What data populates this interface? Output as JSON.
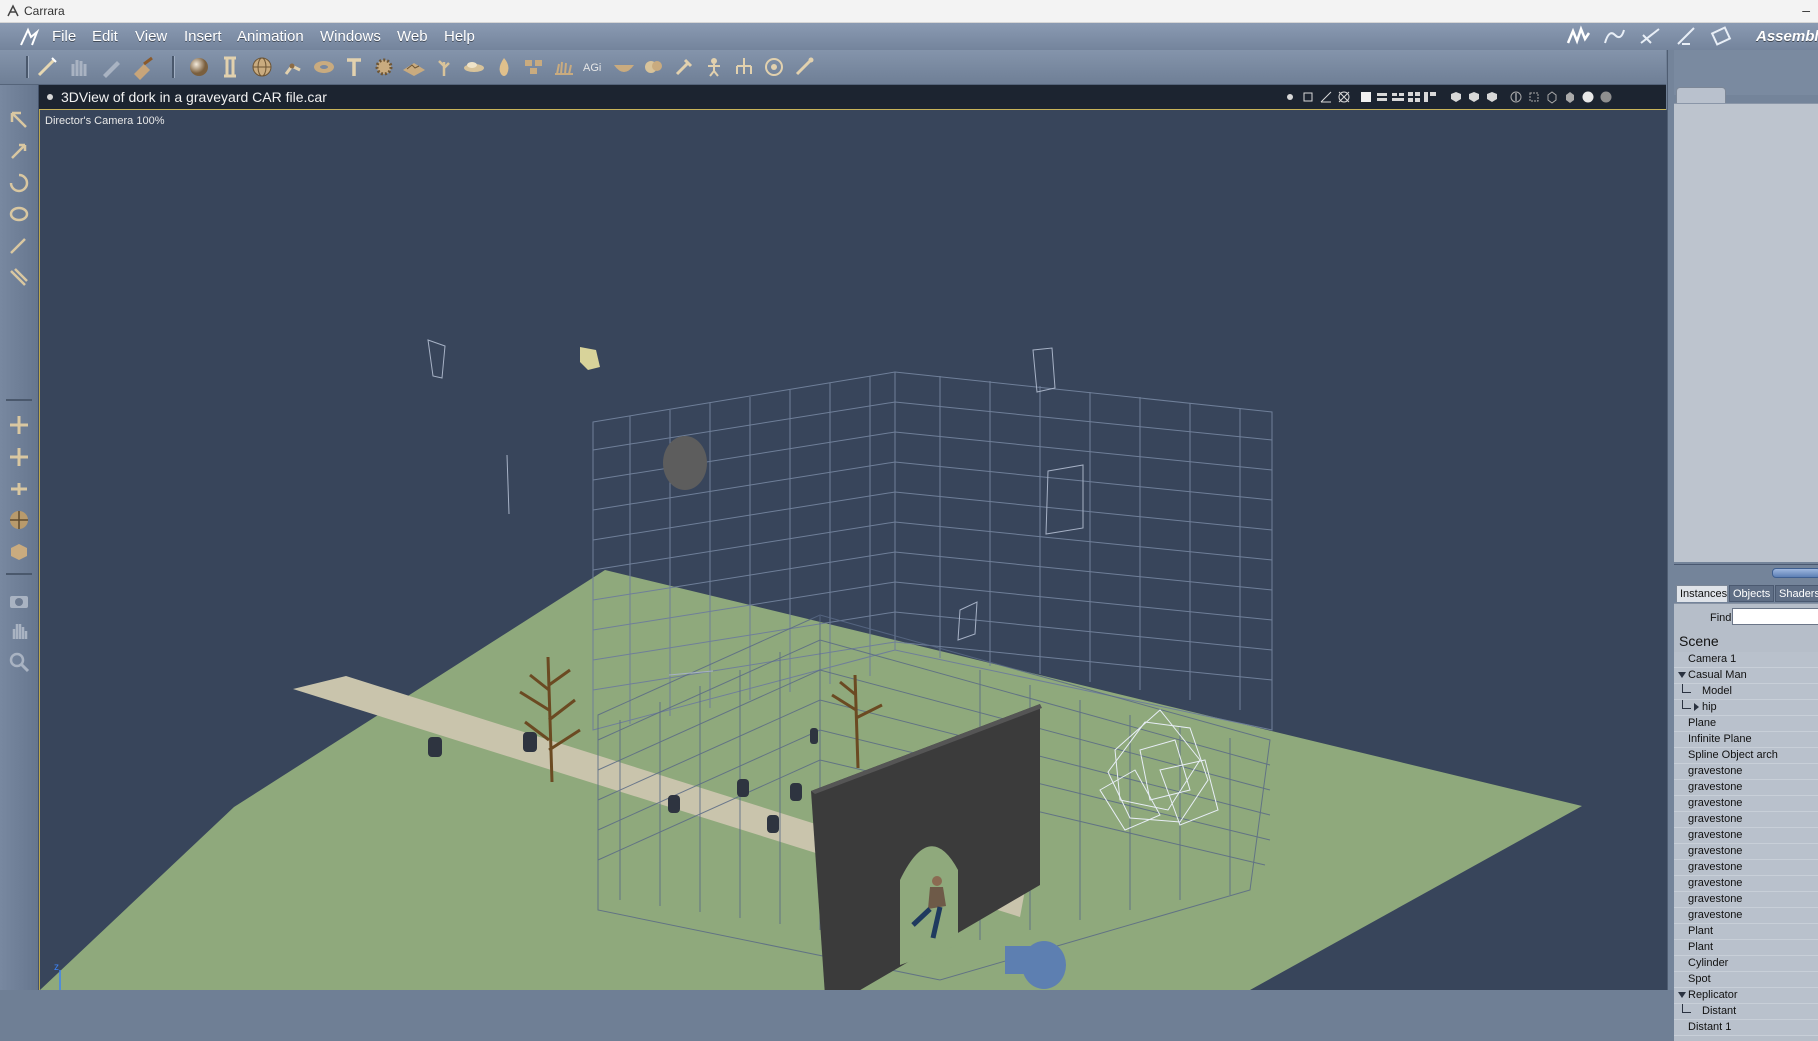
{
  "window": {
    "title": "Carrara",
    "minimize_glyph": "–"
  },
  "menubar": {
    "items": [
      "File",
      "Edit",
      "View",
      "Insert",
      "Animation",
      "Windows",
      "Web",
      "Help"
    ],
    "room_icons": [
      "assemble-room-icon",
      "model-room-icon",
      "storyboard-room-icon",
      "texture-room-icon",
      "render-room-icon"
    ],
    "room_label": "Assemble"
  },
  "toolbar": {
    "icons": [
      "fx-wand-icon",
      "hand-grab-icon",
      "pen-icon",
      "hammer-icon",
      "sphere-icon",
      "column-icon",
      "globe-grid-icon",
      "bone-chain-icon",
      "torus-icon",
      "text-T-icon",
      "gear-primitive-icon",
      "terrain-icon",
      "plant-icon",
      "cloud-icon",
      "fire-icon",
      "replicator-icon",
      "fur-icon",
      "AGi-icon",
      "bowl-icon",
      "metaball-icon",
      "pin-icon",
      "puppet-icon",
      "hierarchy-icon",
      "target-icon",
      "bone-icon"
    ]
  },
  "lefttools": {
    "icons": [
      "select-arrow-icon",
      "rotate-arrow-icon",
      "orbit-icon",
      "twist-icon",
      "paint-brush-icon",
      "knife-icon",
      "move-xy-icon",
      "move-xz-icon",
      "move-yz-icon",
      "trackball-icon",
      "shield-icon",
      "camera-icon",
      "hand-pan-icon",
      "zoom-icon"
    ]
  },
  "viewport": {
    "title": "3DView of dork in a graveyard CAR file.car",
    "camera_label": "Director's Camera 100%",
    "axis_label": "z",
    "header_icons": [
      "lights-icon",
      "grid-toggle-icon",
      "axes-icon",
      "crosshair-icon",
      "layout-single-icon",
      "layout-two-icon",
      "layout-three-icon",
      "layout-four-icon",
      "layout-custom-icon",
      "shield-a-icon",
      "shield-b-icon",
      "shield-c-icon",
      "up-arrow-icon",
      "bbox-icon",
      "wire-cube-icon",
      "solid-cube-icon",
      "sphere-shade-icon",
      "sphere-dark-icon"
    ]
  },
  "rightpanel": {
    "tabs": [
      "Instances",
      "Objects",
      "Shaders"
    ],
    "find_label": "Find:",
    "find_value": "",
    "scene_label": "Scene",
    "tree": [
      {
        "label": "Camera 1",
        "level": 0,
        "twisty": "none"
      },
      {
        "label": "Casual Man",
        "level": 0,
        "twisty": "open"
      },
      {
        "label": "Model",
        "level": 1,
        "twisty": "none"
      },
      {
        "label": "hip",
        "level": 1,
        "twisty": "closed"
      },
      {
        "label": "Plane",
        "level": 0,
        "twisty": "none"
      },
      {
        "label": "Infinite Plane",
        "level": 0,
        "twisty": "none"
      },
      {
        "label": "Spline Object arch",
        "level": 0,
        "twisty": "none"
      },
      {
        "label": "gravestone",
        "level": 0,
        "twisty": "none"
      },
      {
        "label": "gravestone",
        "level": 0,
        "twisty": "none"
      },
      {
        "label": "gravestone",
        "level": 0,
        "twisty": "none"
      },
      {
        "label": "gravestone",
        "level": 0,
        "twisty": "none"
      },
      {
        "label": "gravestone",
        "level": 0,
        "twisty": "none"
      },
      {
        "label": "gravestone",
        "level": 0,
        "twisty": "none"
      },
      {
        "label": "gravestone",
        "level": 0,
        "twisty": "none"
      },
      {
        "label": "gravestone",
        "level": 0,
        "twisty": "none"
      },
      {
        "label": "gravestone",
        "level": 0,
        "twisty": "none"
      },
      {
        "label": "gravestone",
        "level": 0,
        "twisty": "none"
      },
      {
        "label": "Plant",
        "level": 0,
        "twisty": "none"
      },
      {
        "label": "Plant",
        "level": 0,
        "twisty": "none"
      },
      {
        "label": "Cylinder",
        "level": 0,
        "twisty": "none"
      },
      {
        "label": "Spot",
        "level": 0,
        "twisty": "none"
      },
      {
        "label": "Replicator",
        "level": 0,
        "twisty": "open"
      },
      {
        "label": "Distant",
        "level": 1,
        "twisty": "none"
      },
      {
        "label": "Distant 1",
        "level": 0,
        "twisty": "none"
      }
    ]
  },
  "colors": {
    "viewport_bg": "#38455b",
    "ground": "#8fa97c",
    "wall": "#3b3b3b",
    "chrome": "#7888a0"
  }
}
